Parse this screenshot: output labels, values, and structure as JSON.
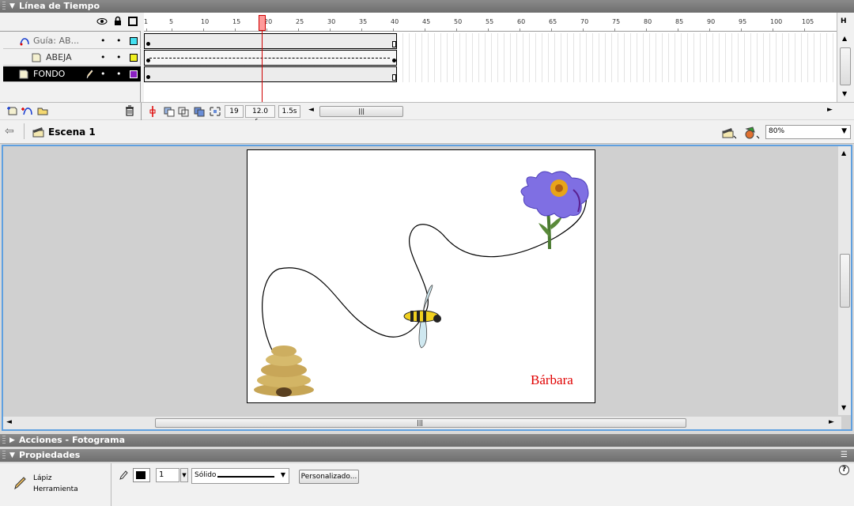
{
  "timeline": {
    "title": "Línea de Tiempo",
    "layers": [
      {
        "name": "Guía: AB...",
        "icon": "guide-layer-icon",
        "color": "#44e0f0"
      },
      {
        "name": "ABEJA",
        "icon": "layer-icon",
        "color": "#f0f020"
      },
      {
        "name": "FONDO",
        "icon": "layer-icon",
        "color": "#8a20c0"
      }
    ],
    "ruler_ticks": [
      "1",
      "5",
      "10",
      "15",
      "20",
      "25",
      "30",
      "35",
      "40",
      "45",
      "50",
      "55",
      "60",
      "65",
      "70",
      "75",
      "80",
      "85",
      "90",
      "95",
      "100",
      "105"
    ],
    "current_frame": "19",
    "fps": "12.0 fps",
    "time": "1.5s"
  },
  "scene": {
    "name": "Escena 1",
    "zoom": "80%"
  },
  "stage": {
    "text": "Bárbara",
    "text_color": "#e00000"
  },
  "panels": {
    "actions": "Acciones - Fotograma",
    "properties": "Propiedades"
  },
  "properties": {
    "tool_name": "Lápiz",
    "tool_type": "Herramienta",
    "stroke_width": "1",
    "stroke_style": "Sólido",
    "custom_button": "Personalizado...",
    "help": "?"
  }
}
